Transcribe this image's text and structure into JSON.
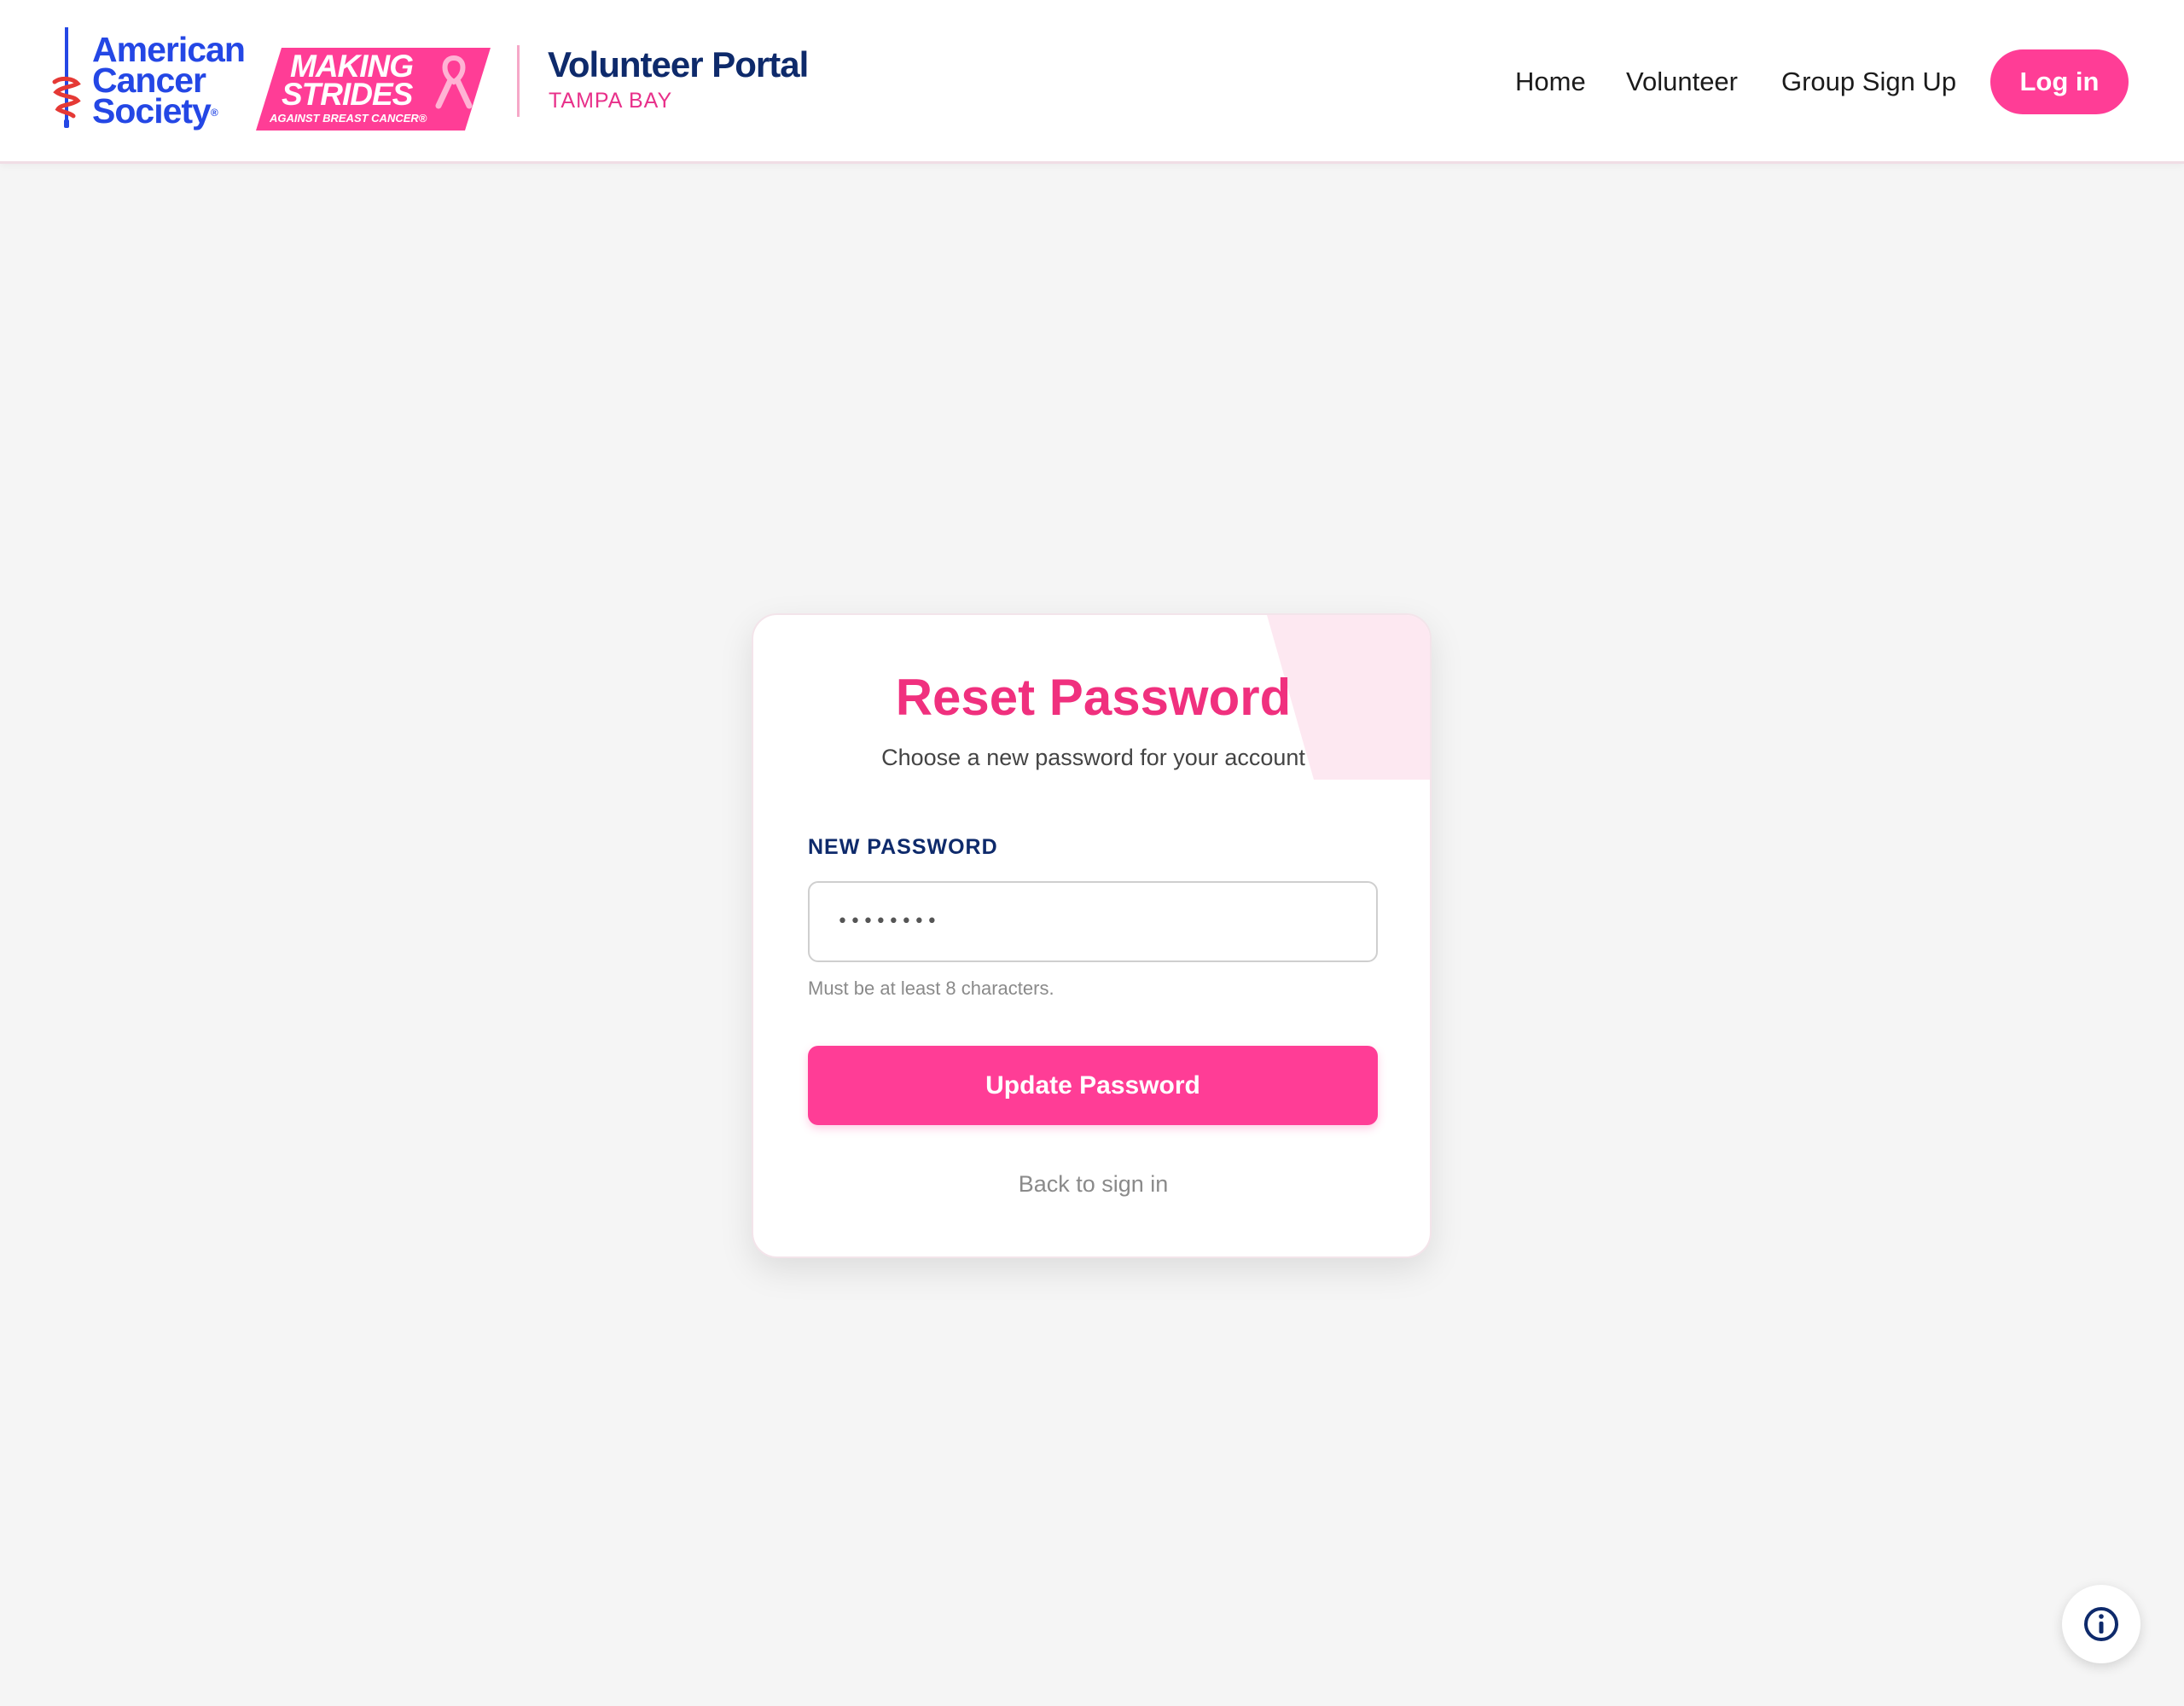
{
  "header": {
    "acs_logo": {
      "line1": "American",
      "line2": "Cancer",
      "line3": "Society",
      "registered": "®"
    },
    "strides_logo": {
      "line1": "MAKING",
      "line2": "STRIDES",
      "line3": "AGAINST BREAST CANCER®"
    },
    "portal_title": "Volunteer Portal",
    "portal_subtitle": "TAMPA BAY",
    "nav": {
      "home": "Home",
      "volunteer": "Volunteer",
      "group_signup": "Group Sign Up"
    },
    "login_label": "Log in"
  },
  "card": {
    "title": "Reset Password",
    "subtitle": "Choose a new password for your account",
    "field_label": "NEW PASSWORD",
    "password_value": "••••••••",
    "helper_text": "Must be at least 8 characters.",
    "submit_label": "Update Password",
    "back_link": "Back to sign in"
  },
  "icons": {
    "acs_sword": "sword-icon",
    "ribbon": "pink-ribbon-icon",
    "info": "info-icon"
  },
  "colors": {
    "brand_pink": "#ff3d96",
    "title_pink": "#f0307e",
    "navy": "#0e2a6b",
    "acs_blue": "#2447e5",
    "corner_tint": "#fde8f1",
    "background": "#f5f5f5"
  }
}
